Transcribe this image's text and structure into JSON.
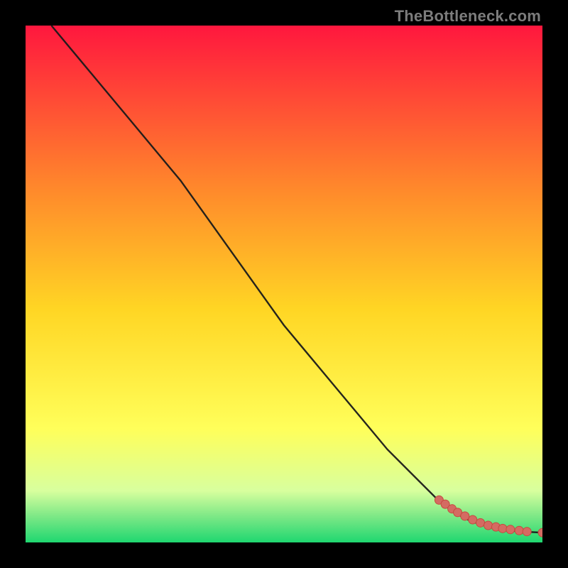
{
  "watermark": "TheBottleneck.com",
  "colors": {
    "gradient_top": "#ff173e",
    "gradient_mid1": "#ff8a2b",
    "gradient_mid2": "#ffd624",
    "gradient_mid3": "#ffff5a",
    "gradient_green_pale": "#d8ff9e",
    "gradient_green_mid": "#7ce886",
    "gradient_bottom": "#1fd770",
    "line_color": "#1a1a1a",
    "marker_fill": "#d46b62",
    "marker_edge": "#c54a3f"
  },
  "chart_data": {
    "type": "line",
    "title": "",
    "xlabel": "",
    "ylabel": "",
    "xlim": [
      0,
      100
    ],
    "ylim": [
      0,
      100
    ],
    "series": [
      {
        "name": "curve",
        "x": [
          5,
          10,
          15,
          20,
          25,
          30,
          35,
          40,
          45,
          50,
          55,
          60,
          65,
          70,
          75,
          80,
          82,
          84,
          86,
          88,
          90,
          92,
          94,
          96,
          98,
          100
        ],
        "y": [
          100,
          94,
          88,
          82,
          76,
          70,
          63,
          56,
          49,
          42,
          36,
          30,
          24,
          18,
          13,
          8,
          6.5,
          5.2,
          4.2,
          3.5,
          3.0,
          2.6,
          2.3,
          2.1,
          2.0,
          1.9
        ]
      }
    ],
    "markers": {
      "name": "bottleneck-points",
      "x": [
        80.0,
        81.2,
        82.5,
        83.6,
        85.0,
        86.5,
        88.0,
        89.5,
        91.0,
        92.3,
        93.8,
        95.5,
        97.0,
        100.0
      ],
      "y": [
        8.2,
        7.4,
        6.5,
        5.8,
        5.1,
        4.4,
        3.8,
        3.3,
        3.0,
        2.7,
        2.5,
        2.3,
        2.1,
        1.9
      ]
    }
  }
}
